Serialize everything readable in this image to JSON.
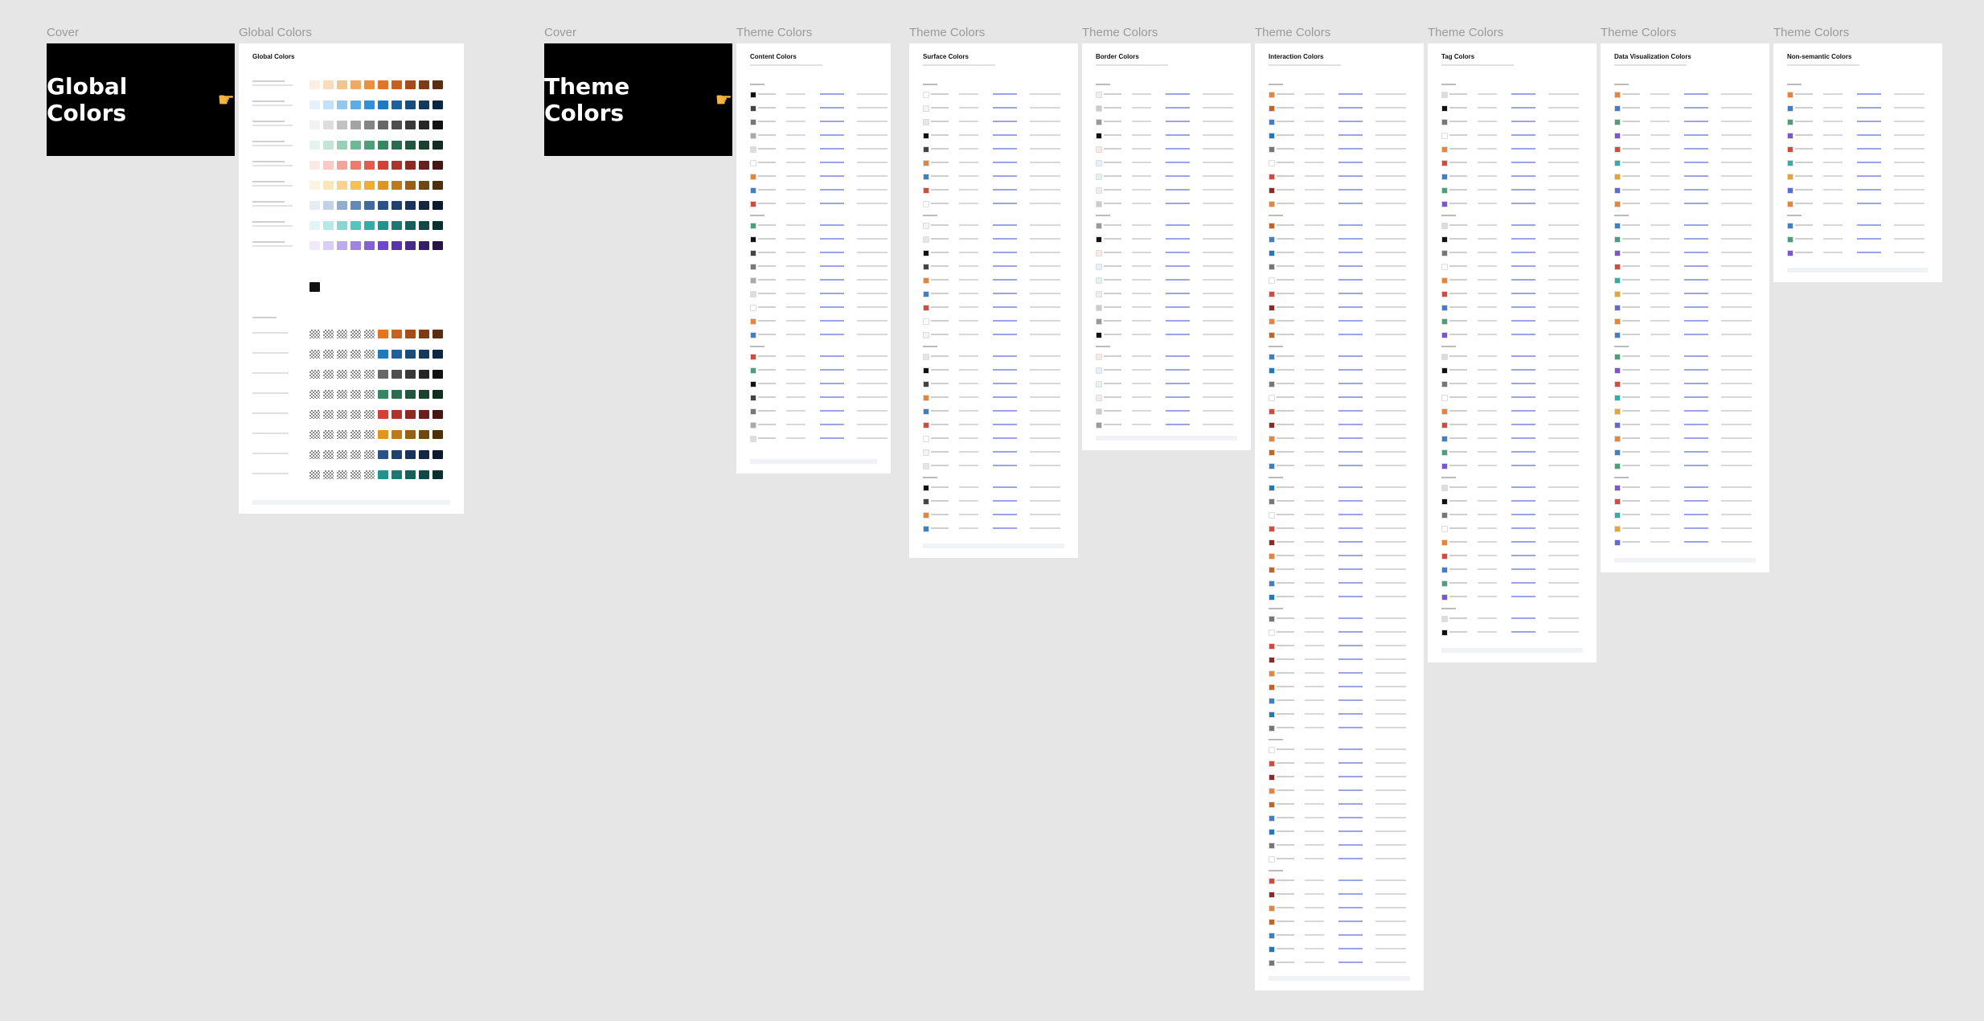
{
  "labels": {
    "cover1": "Cover",
    "global": "Global Colors",
    "cover2": "Cover",
    "theme1": "Theme Colors",
    "theme2": "Theme Colors",
    "theme3": "Theme Colors",
    "theme4": "Theme Colors",
    "theme5": "Theme Colors",
    "theme6": "Theme Colors",
    "theme7": "Theme Colors"
  },
  "covers": {
    "global_text": "Global Colors",
    "theme_text": "Theme Colors",
    "pointer_icon": "pointing-hand-icon"
  },
  "pages": {
    "global": "Global Colors",
    "content": "Content Colors",
    "surface": "Surface Colors",
    "border": "Border Colors",
    "interaction": "Interaction Colors",
    "tag": "Tag Colors",
    "dataviz": "Data Visualization Colors",
    "nonsemantic": "Non-semantic Colors"
  },
  "palette": {
    "orange": [
      "#fcefdf",
      "#f8dcbc",
      "#f4c48f",
      "#f0a964",
      "#ec8f3f",
      "#e27427",
      "#c8601e",
      "#a44d1a",
      "#7e3c16",
      "#5a2c12"
    ],
    "blue": [
      "#e3f1fb",
      "#c2e0f6",
      "#92c7ef",
      "#5fabe6",
      "#3190d9",
      "#1f78c2",
      "#1b619f",
      "#174d7e",
      "#123a5f",
      "#0c2841"
    ],
    "gray": [
      "#f2f2f2",
      "#dddddd",
      "#c2c2c2",
      "#a3a3a3",
      "#848484",
      "#676767",
      "#4e4e4e",
      "#393939",
      "#262626",
      "#121212"
    ],
    "green": [
      "#e5f3ed",
      "#c4e4d6",
      "#98cfb7",
      "#6db896",
      "#4ba07a",
      "#358663",
      "#2a6c50",
      "#22563f",
      "#1a4130",
      "#112c20"
    ],
    "red": [
      "#fde8e6",
      "#fac9c4",
      "#f5a39b",
      "#ef7b70",
      "#e85a4e",
      "#d34036",
      "#b0332b",
      "#8c2923",
      "#691f1b",
      "#471512"
    ],
    "yellow": [
      "#fdf4e0",
      "#fbe6b9",
      "#f8d488",
      "#f4c058",
      "#f0ad32",
      "#e0951e",
      "#bd7a17",
      "#966112",
      "#70480e",
      "#4b3009"
    ],
    "navy": [
      "#e6ecf4",
      "#c3d1e6",
      "#93adcf",
      "#6488b7",
      "#3f6aa2",
      "#2b5189",
      "#21416f",
      "#1a3459",
      "#132743",
      "#0c1a2e"
    ],
    "teal": [
      "#e0f5f4",
      "#b8e8e5",
      "#86d7d2",
      "#56c3bc",
      "#31aea6",
      "#22938c",
      "#1b7872",
      "#16605b",
      "#104845",
      "#0a302e"
    ],
    "purple": [
      "#efe9fb",
      "#dacdf6",
      "#bea8ee",
      "#a082e5",
      "#8560db",
      "#6d45cf",
      "#5934ad",
      "#47298a",
      "#351f67",
      "#241544"
    ]
  },
  "dataviz": [
    "#e8833a",
    "#3f7fc7",
    "#4ba07a",
    "#7a55d6",
    "#d64a3c",
    "#31aea6",
    "#e6a530",
    "#5c6bd6"
  ]
}
